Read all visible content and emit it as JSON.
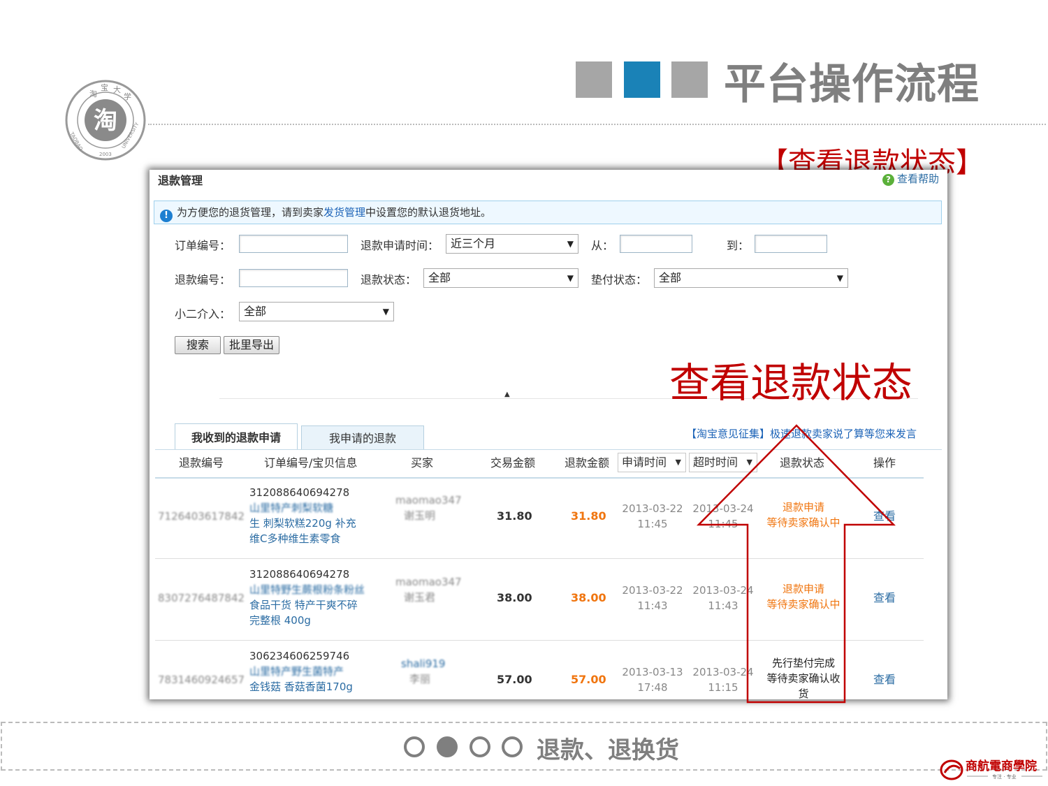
{
  "header": {
    "title": "平台操作流程",
    "squares_colors": [
      "#a6a6a6",
      "#1a82b7",
      "#a6a6a6"
    ],
    "subtitle": "【查看退款状态】"
  },
  "logo": {
    "ring_text": "淘宝大学",
    "center_char": "淘",
    "english": "TAOBAO UNIVERSITY",
    "year": "2003"
  },
  "screenshot": {
    "title": "退款管理",
    "help_link": "查看帮助",
    "notice": {
      "before": "为方便您的退货管理，请到卖家",
      "link": "发货管理",
      "after": "中设置您的默认退货地址。"
    },
    "form": {
      "order_no_label": "订单编号：",
      "apply_time_label": "退款申请时间：",
      "apply_time_value": "近三个月",
      "from_label": "从：",
      "to_label": "到：",
      "refund_no_label": "退款编号：",
      "refund_status_label": "退款状态：",
      "refund_status_value": "全部",
      "advance_status_label": "垫付状态：",
      "advance_status_value": "全部",
      "xiaoer_label": "小二介入：",
      "xiaoer_value": "全部",
      "search_button": "搜索",
      "export_button": "批里导出"
    },
    "annotation": "查看退款状态",
    "tabs": [
      {
        "label": "我收到的退款申请",
        "active": true
      },
      {
        "label": "我申请的退款",
        "active": false
      }
    ],
    "feedback": "【淘宝意见征集】极速退款卖家说了算等您来发言",
    "columns": [
      "退款编号",
      "订单编号/宝贝信息",
      "买家",
      "交易金额",
      "退款金额",
      "申请时间",
      "超时时间",
      "退款状态",
      "操作"
    ],
    "rows": [
      {
        "refund_no": "7126403617842",
        "order_no": "312088640694278",
        "item_blur": "山里特产刺梨软糖",
        "item_lines": [
          "生 刺梨软糕220g 补充",
          "维C多种维生素零食"
        ],
        "buyer_blur": [
          "maomao347",
          "谢玉明"
        ],
        "trade_amount": "31.80",
        "refund_amount": "31.80",
        "apply_time": [
          "2013-03-22",
          "11:45"
        ],
        "timeout_time": [
          "2013-03-24",
          "11:45"
        ],
        "status": [
          "退款申请",
          "等待卖家确认中"
        ],
        "status_color": "#f0750f",
        "action": "查看"
      },
      {
        "refund_no": "8307276487842",
        "order_no": "312088640694278",
        "item_blur": "山里特野生蕨根粉条粉丝",
        "item_lines": [
          "食品干货 特产干爽不碎",
          "完整根 400g"
        ],
        "buyer_blur": [
          "maomao347",
          "谢玉君"
        ],
        "trade_amount": "38.00",
        "refund_amount": "38.00",
        "apply_time": [
          "2013-03-22",
          "11:43"
        ],
        "timeout_time": [
          "2013-03-24",
          "11:43"
        ],
        "status": [
          "退款申请",
          "等待卖家确认中"
        ],
        "status_color": "#f0750f",
        "action": "查看"
      },
      {
        "refund_no": "7831460924657",
        "order_no": "306234606259746",
        "item_blur": "山里特产野生菌特产",
        "item_lines": [
          "金钱菇 香菇香菌170g"
        ],
        "buyer_blur": [
          "shali919",
          "李丽"
        ],
        "trade_amount": "57.00",
        "refund_amount": "57.00",
        "apply_time": [
          "2013-03-13",
          "17:48"
        ],
        "timeout_time": [
          "2013-03-24",
          "11:15"
        ],
        "status": [
          "先行垫付完成",
          "等待卖家确认收",
          "货"
        ],
        "status_color": "#222222",
        "action": "查看"
      }
    ]
  },
  "footer": {
    "dots": [
      "empty",
      "filled",
      "empty",
      "empty"
    ],
    "text": "退款、退换货"
  },
  "brand": {
    "name": "商航電商學院",
    "tagline": "专注 · 专业"
  }
}
